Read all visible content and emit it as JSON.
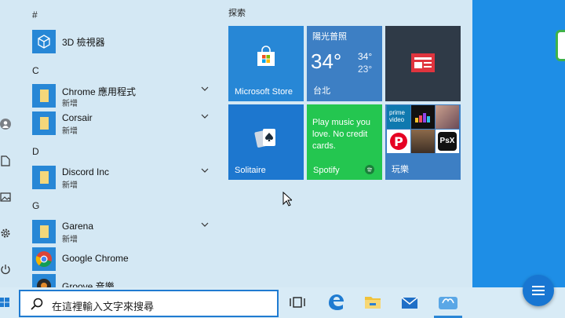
{
  "start_menu": {
    "letters": [
      "#",
      "C",
      "D",
      "G"
    ],
    "apps": [
      {
        "name": "3D 檢視器",
        "sub": ""
      },
      {
        "name": "Chrome 應用程式",
        "sub": "新增"
      },
      {
        "name": "Corsair",
        "sub": "新增"
      },
      {
        "name": "Discord Inc",
        "sub": "新增"
      },
      {
        "name": "Garena",
        "sub": "新增"
      },
      {
        "name": "Google Chrome",
        "sub": ""
      },
      {
        "name": "Groove 音樂",
        "sub": ""
      }
    ],
    "group_title": "探索",
    "tiles": {
      "store": "Microsoft Store",
      "weather": {
        "condition": "陽光普照",
        "temp": "34°",
        "high": "34°",
        "low": "23°",
        "city": "台北"
      },
      "solitaire": "Solitaire",
      "spotify": {
        "text": "Play music you love. No credit cards.",
        "label": "Spotify"
      },
      "play": {
        "label": "玩樂",
        "prime_line1": "prime",
        "prime_line2": "video",
        "psx": "PsX"
      }
    }
  },
  "taskbar": {
    "search_placeholder": "在這裡輸入文字來搜尋"
  },
  "colors": {
    "accent": "#1f7bd1",
    "tile_blue": "#2787d6",
    "spotify_green": "#24c650",
    "news_tile": "#2f3a47"
  },
  "icons": [
    "windows-logo-icon",
    "user-icon",
    "document-icon",
    "picture-icon",
    "settings-icon",
    "power-icon",
    "search-icon",
    "task-view-icon",
    "edge-icon",
    "file-explorer-icon",
    "mail-icon",
    "store-bag-icon",
    "menu-icon"
  ]
}
